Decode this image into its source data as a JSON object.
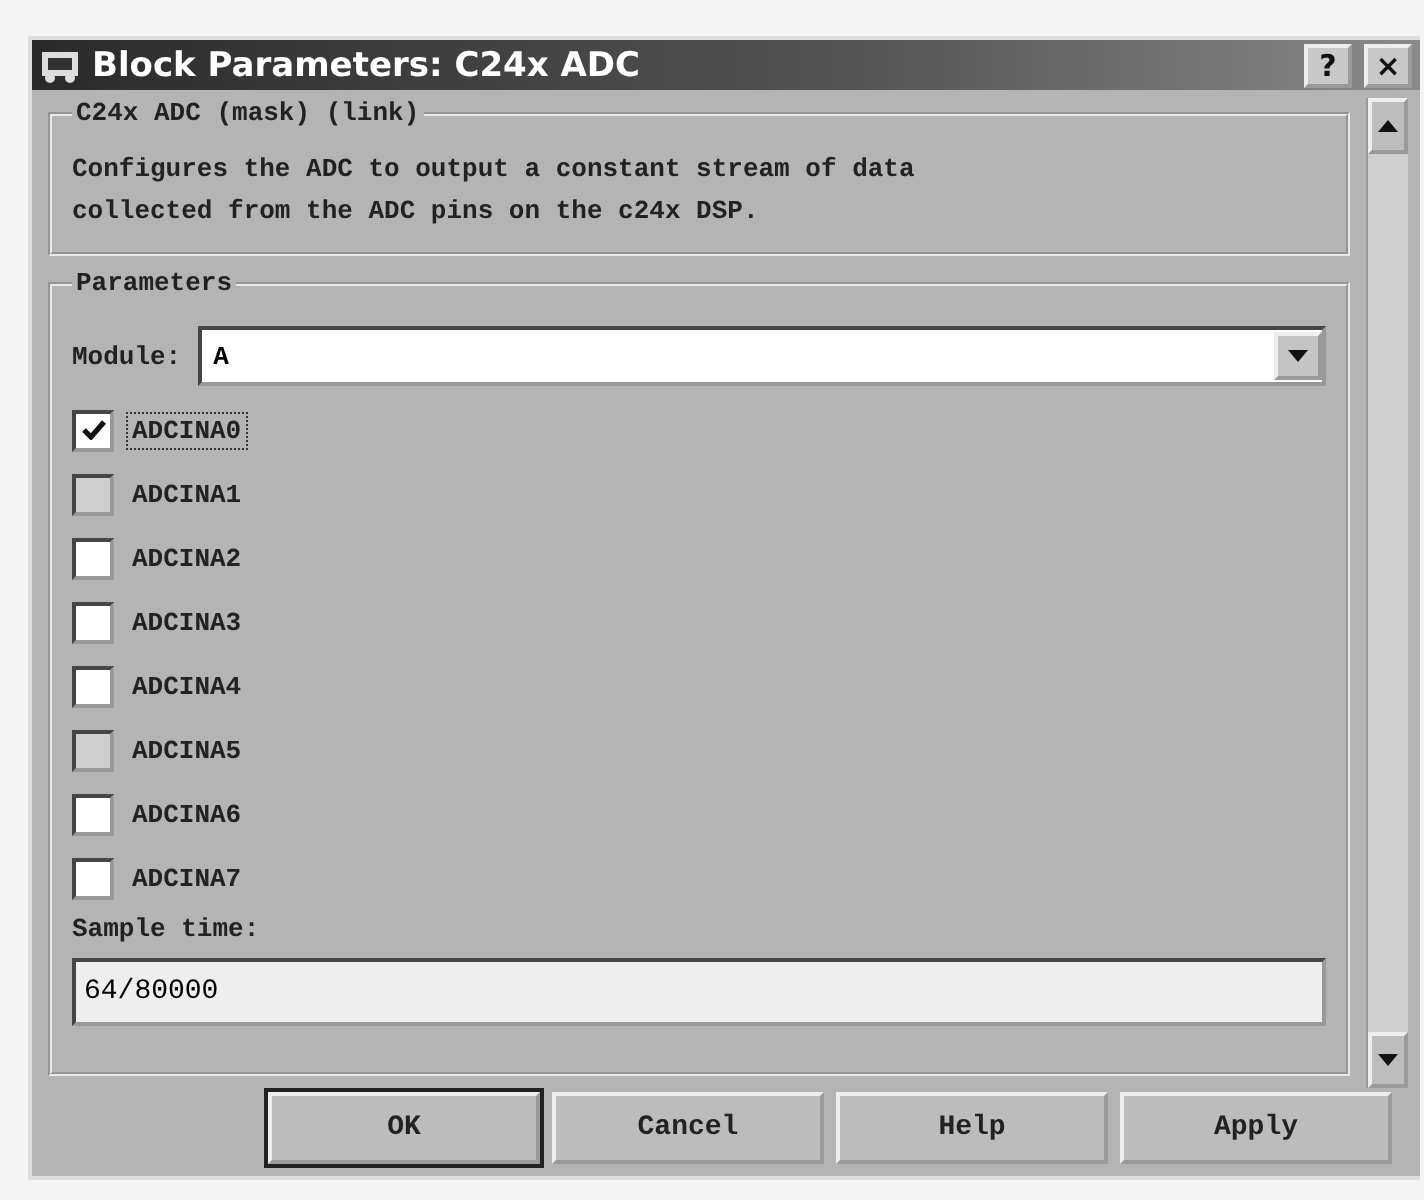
{
  "window": {
    "title": "Block Parameters: C24x ADC",
    "controls": [
      "?",
      "×"
    ]
  },
  "description_group": {
    "title": "C24x ADC (mask) (link)",
    "text": "Configures the ADC to output a constant stream of data collected from the ADC pins on the c24x DSP."
  },
  "parameters_group": {
    "title": "Parameters",
    "module": {
      "label": "Module:",
      "value": "A"
    },
    "checkboxes": [
      {
        "label": "ADCINA0",
        "checked": true,
        "disabled": false,
        "focused": true
      },
      {
        "label": "ADCINA1",
        "checked": false,
        "disabled": true,
        "focused": false
      },
      {
        "label": "ADCINA2",
        "checked": false,
        "disabled": false,
        "focused": false
      },
      {
        "label": "ADCINA3",
        "checked": false,
        "disabled": false,
        "focused": false
      },
      {
        "label": "ADCINA4",
        "checked": false,
        "disabled": false,
        "focused": false
      },
      {
        "label": "ADCINA5",
        "checked": false,
        "disabled": true,
        "focused": false
      },
      {
        "label": "ADCINA6",
        "checked": false,
        "disabled": false,
        "focused": false
      },
      {
        "label": "ADCINA7",
        "checked": false,
        "disabled": false,
        "focused": false
      }
    ],
    "sample_time": {
      "label": "Sample time:",
      "value": "64/80000"
    }
  },
  "buttons": [
    {
      "label": "OK",
      "default": true
    },
    {
      "label": "Cancel",
      "default": false
    },
    {
      "label": "Help",
      "default": false
    },
    {
      "label": "Apply",
      "default": false
    }
  ]
}
